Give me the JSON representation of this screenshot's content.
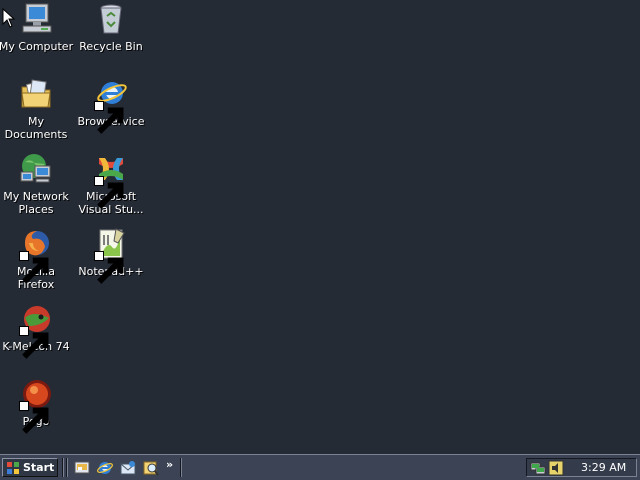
{
  "desktop": {
    "background_color": "#252b35",
    "icons": [
      {
        "label": "My Computer",
        "icon": "my-computer-icon",
        "shortcut": false
      },
      {
        "label": "Recycle Bin",
        "icon": "recycle-bin-icon",
        "shortcut": false
      },
      {
        "label": "My Documents",
        "icon": "my-documents-icon",
        "shortcut": false
      },
      {
        "label": "Browservice",
        "icon": "internet-explorer-icon",
        "shortcut": true
      },
      {
        "label": "My Network Places",
        "icon": "my-network-places-icon",
        "shortcut": false
      },
      {
        "label": "Microsoft Visual Stu...",
        "icon": "visual-studio-icon",
        "shortcut": true
      },
      {
        "label": "Mozilla Firefox",
        "icon": "firefox-icon",
        "shortcut": true
      },
      {
        "label": "Notepad++",
        "icon": "notepadpp-icon",
        "shortcut": true
      },
      {
        "label": "K-Meleon 74",
        "icon": "k-meleon-icon",
        "shortcut": true
      },
      {
        "label": "Pego",
        "icon": "pego-icon",
        "shortcut": true
      }
    ]
  },
  "taskbar": {
    "start_label": "Start",
    "quick_launch": [
      {
        "icon": "show-desktop-icon"
      },
      {
        "icon": "internet-explorer-icon"
      },
      {
        "icon": "outlook-express-icon"
      },
      {
        "icon": "explorer-search-icon"
      }
    ],
    "more_label": "»",
    "tray": [
      {
        "icon": "network-tray-icon"
      },
      {
        "icon": "volume-tray-icon"
      }
    ],
    "clock": "3:29 AM"
  }
}
